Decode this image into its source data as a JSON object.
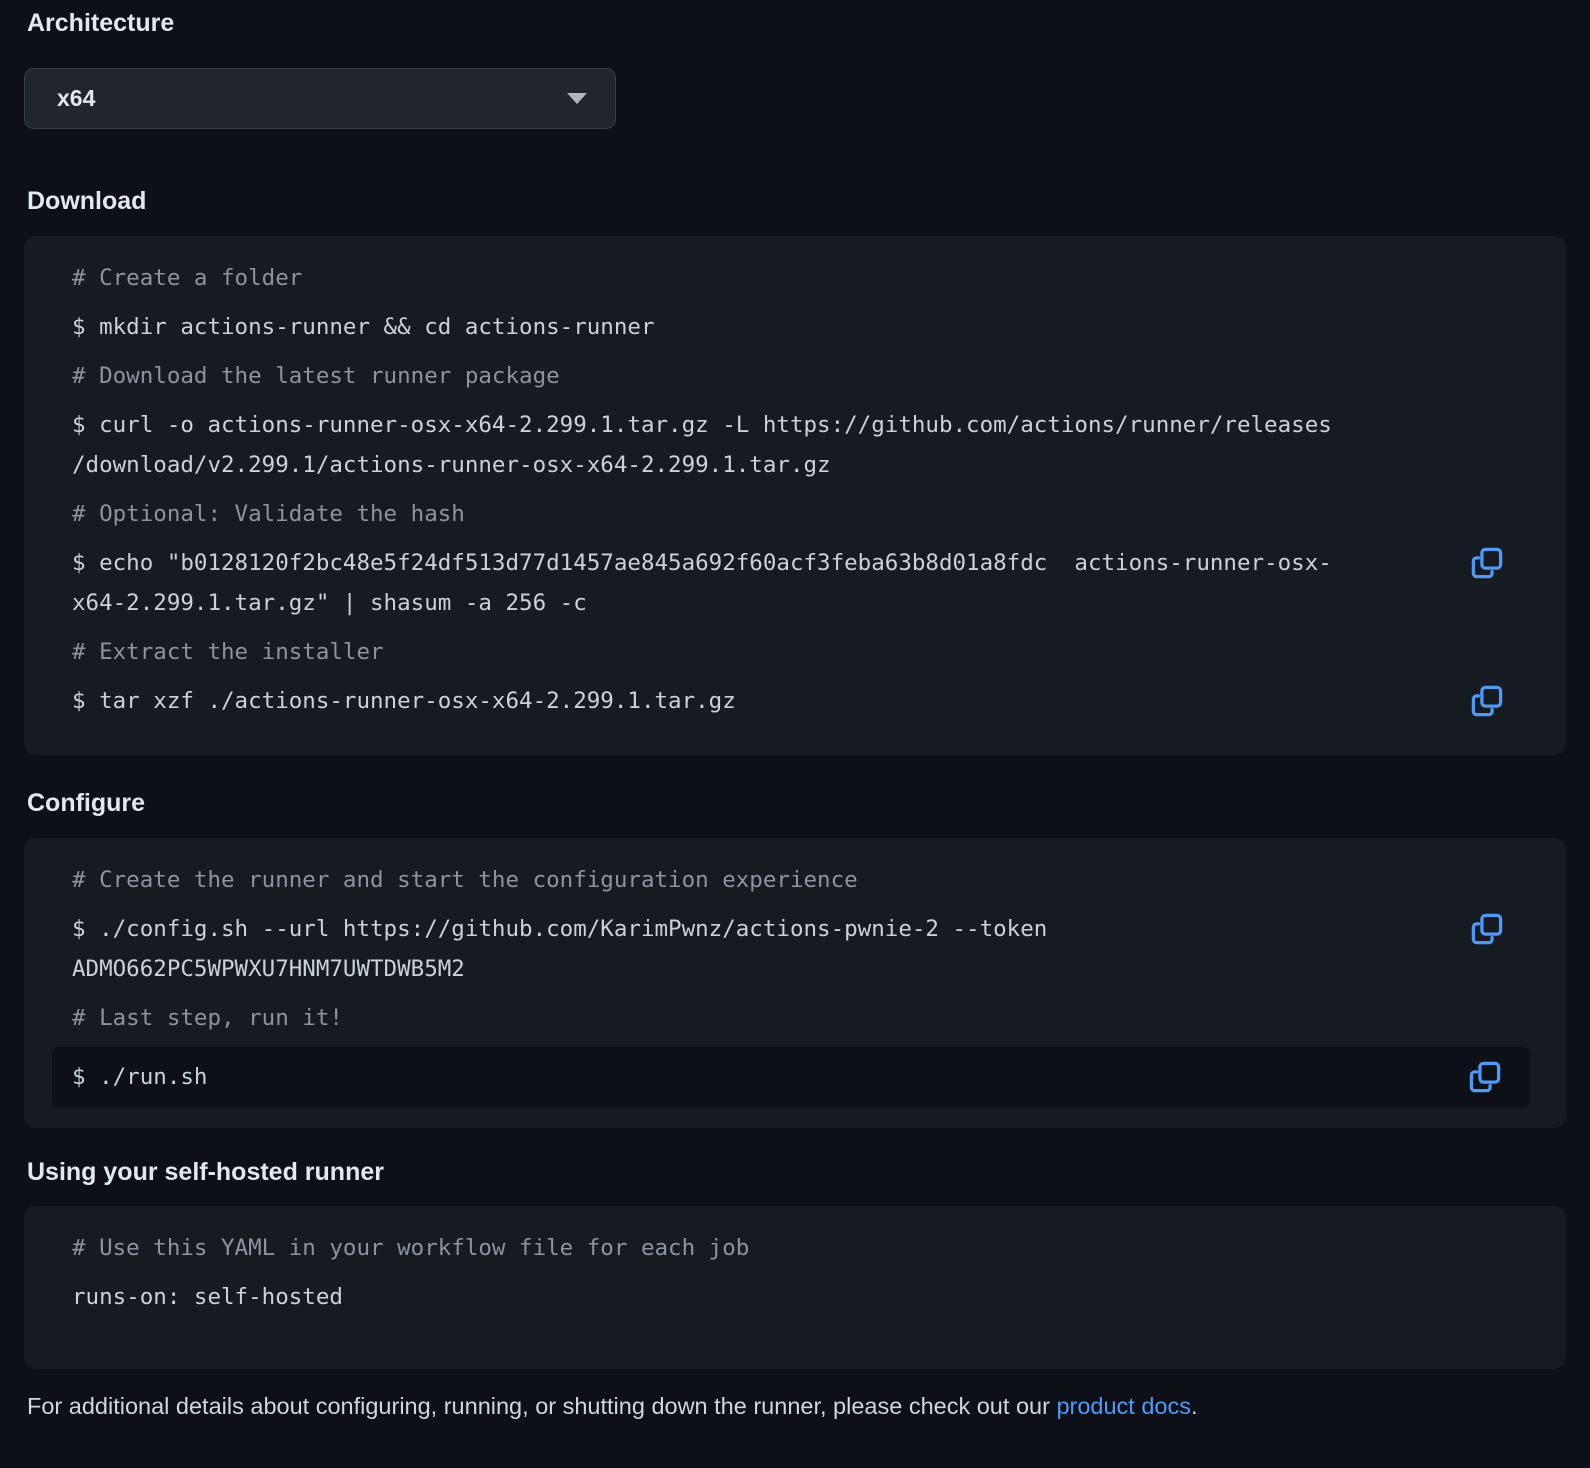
{
  "colors": {
    "page_bg": "#0d1117",
    "block_bg": "#161b22",
    "highlight_bg": "#0d1117",
    "heading": "#e1e8ef",
    "comment": "#8b949e",
    "command": "#c9d1d9",
    "accent_blue": "#4e9af8",
    "select_bg": "#21262d",
    "select_border": "#363d46"
  },
  "architecture": {
    "heading": "Architecture",
    "selected_value": "x64",
    "chevron_icon": "chevron-down-icon"
  },
  "download": {
    "heading": "Download",
    "lines": [
      {
        "kind": "comment",
        "text": "# Create a folder"
      },
      {
        "kind": "command",
        "text": "$ mkdir actions-runner && cd actions-runner"
      },
      {
        "kind": "comment",
        "text": "# Download the latest runner package"
      },
      {
        "kind": "command",
        "text": "$ curl -o actions-runner-osx-x64-2.299.1.tar.gz -L https://github.com/actions/runner/releases"
      },
      {
        "kind": "wrap",
        "text": "/download/v2.299.1/actions-runner-osx-x64-2.299.1.tar.gz"
      },
      {
        "kind": "comment",
        "text": "# Optional: Validate the hash"
      },
      {
        "kind": "command",
        "text": "$ echo \"b0128120f2bc48e5f24df513d77d1457ae845a692f60acf3feba63b8d01a8fdc  actions-runner-osx-",
        "copy": true
      },
      {
        "kind": "wrap",
        "text": "x64-2.299.1.tar.gz\" | shasum -a 256 -c"
      },
      {
        "kind": "comment",
        "text": "# Extract the installer"
      },
      {
        "kind": "command",
        "text": "$ tar xzf ./actions-runner-osx-x64-2.299.1.tar.gz",
        "copy": true
      }
    ]
  },
  "configure": {
    "heading": "Configure",
    "lines": [
      {
        "kind": "comment",
        "text": "# Create the runner and start the configuration experience"
      },
      {
        "kind": "command",
        "text": "$ ./config.sh --url https://github.com/KarimPwnz/actions-pwnie-2 --token",
        "copy": true
      },
      {
        "kind": "wrap",
        "text": "ADMO662PC5WPWXU7HNM7UWTDWB5M2"
      },
      {
        "kind": "comment",
        "text": "# Last step, run it!"
      },
      {
        "kind": "command",
        "text": "$ ./run.sh",
        "copy": true,
        "highlight": true
      }
    ]
  },
  "usage": {
    "heading": "Using your self-hosted runner",
    "lines": [
      {
        "kind": "comment",
        "text": "# Use this YAML in your workflow file for each job"
      },
      {
        "kind": "command",
        "text": "runs-on: self-hosted"
      }
    ]
  },
  "footer": {
    "text_before": "For additional details about configuring, running, or shutting down the runner, please check out our ",
    "link_label": "product docs",
    "text_after": "."
  }
}
